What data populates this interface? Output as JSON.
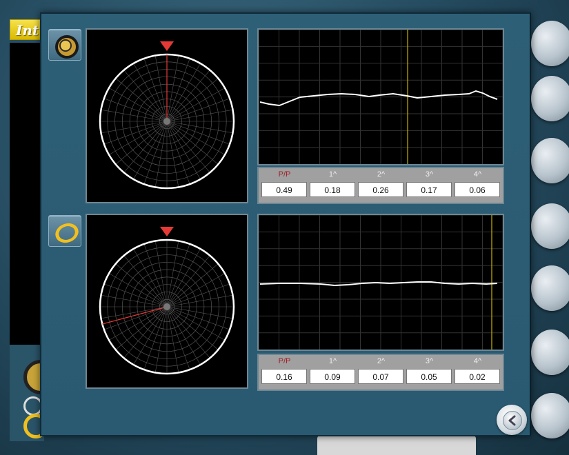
{
  "app": {
    "title_fragment": "Int"
  },
  "lenses": [
    {
      "name": "top",
      "metrics": {
        "headers": [
          "P/P",
          "1^",
          "2^",
          "3^",
          "4^"
        ],
        "values": [
          "0.49",
          "0.18",
          "0.26",
          "0.17",
          "0.06"
        ]
      }
    },
    {
      "name": "bottom",
      "metrics": {
        "headers": [
          "P/P",
          "1^",
          "2^",
          "3^",
          "4^"
        ],
        "values": [
          "0.16",
          "0.09",
          "0.07",
          "0.05",
          "0.02"
        ]
      }
    }
  ],
  "colors": {
    "modal_bg": "#2a5a71",
    "marker": "#e53935",
    "trace": "#ffffff",
    "cursor": "#c8b400",
    "pp_label": "#a11d24"
  },
  "icons": [
    "lens-ring-dark-icon",
    "lens-ring-yellow-icon",
    "back-arrow-icon"
  ]
}
